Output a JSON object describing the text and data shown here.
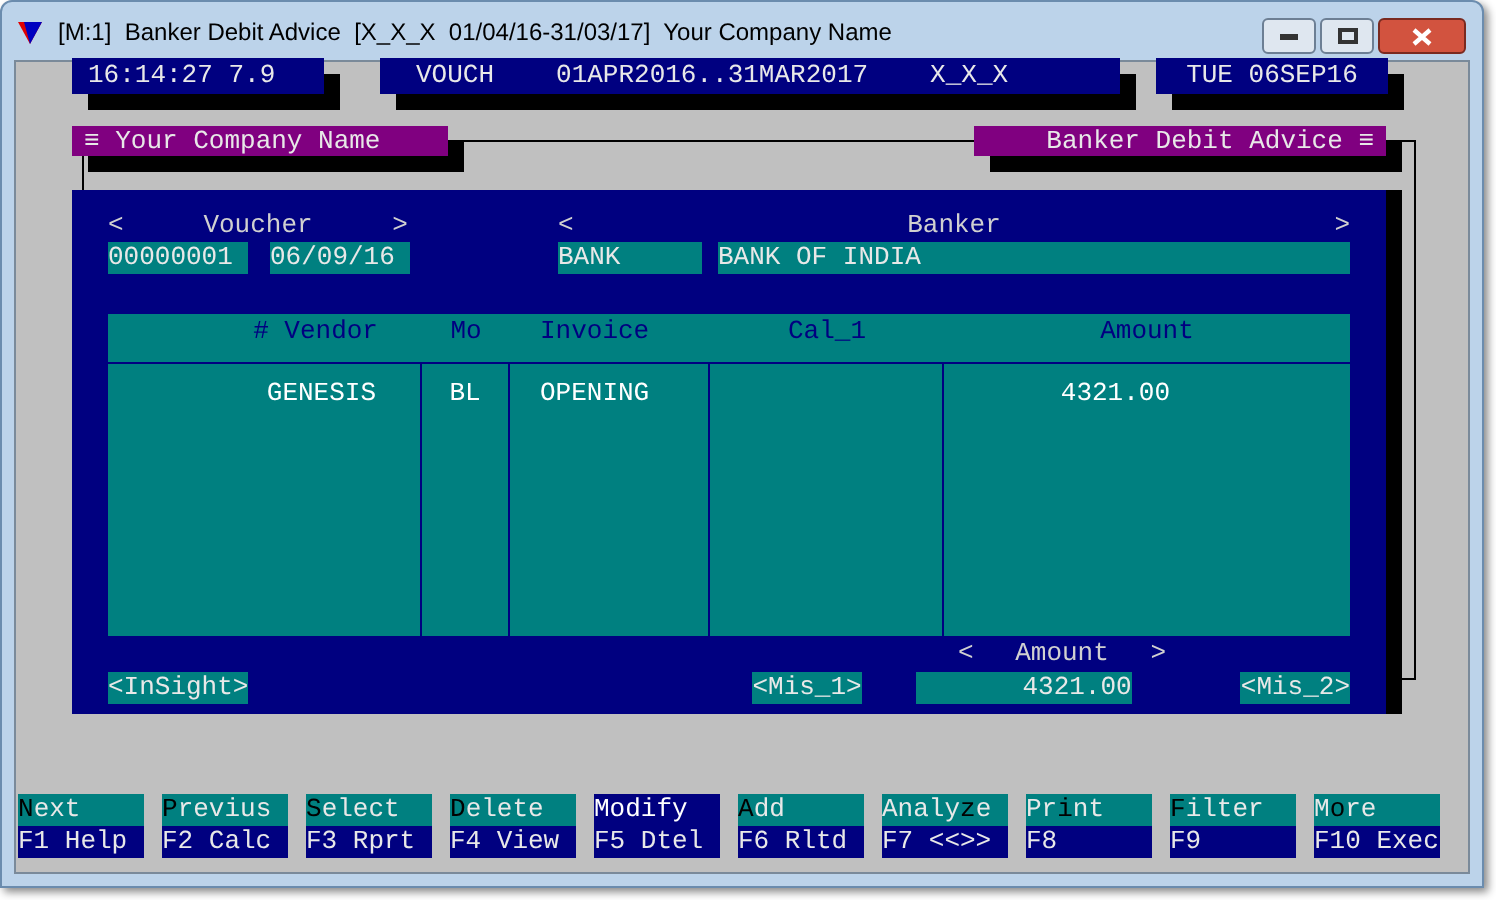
{
  "window": {
    "title": "[M:1]  Banker Debit Advice  [X_X_X  01/04/16-31/03/17]  Your Company Name"
  },
  "status_bar": {
    "clock": "16:14:27 7.9",
    "mode": "VOUCH",
    "period": "01APR2016..31MAR2017",
    "user": "X_X_X",
    "date": "TUE 06SEP16"
  },
  "panel": {
    "left_tab": "≡ Your Company Name",
    "right_tab": "Banker Debit Advice ≡"
  },
  "voucher": {
    "label_left": "<",
    "label": "Voucher",
    "label_right": ">",
    "number": "00000001",
    "date": "06/09/16"
  },
  "banker": {
    "label_left": "<",
    "label": "Banker",
    "label_right": ">",
    "code": "BANK",
    "name": "BANK OF INDIA"
  },
  "table": {
    "columns": [
      "# Vendor",
      "Mo",
      "Invoice",
      "Cal_1",
      "Amount"
    ],
    "rows": [
      [
        "GENESIS",
        "BL",
        "OPENING",
        "",
        "4321.00"
      ]
    ]
  },
  "footer": {
    "insight": "<InSight>",
    "mis_1": "<Mis_1>",
    "amount_left": "<",
    "amount_label": "Amount",
    "amount_right": ">",
    "amount": "4321.00",
    "mis_2": "<Mis_2>"
  },
  "function_keys": [
    {
      "hotkey": "N",
      "after": "ext",
      "key": "F1 Help",
      "selected": false
    },
    {
      "hotkey": "P",
      "after": "revius",
      "key": "F2 Calc",
      "selected": false
    },
    {
      "hotkey": "S",
      "after": "elect",
      "key": "F3 Rprt",
      "selected": false
    },
    {
      "hotkey": "D",
      "after": "elete",
      "key": "F4 View",
      "selected": false
    },
    {
      "before": "Modify",
      "key": "F5 Dtel",
      "selected": true
    },
    {
      "hotkey": "A",
      "after": "dd",
      "key": "F6 Rltd",
      "selected": false
    },
    {
      "before": "Analy",
      "hotkey": "z",
      "after": "e",
      "key": "F7 <<>>",
      "selected": false
    },
    {
      "before": "Pr",
      "hotkey": "i",
      "after": "nt",
      "key": "F8",
      "selected": false
    },
    {
      "hotkey": "F",
      "after": "ilter",
      "key": "F9",
      "selected": false
    },
    {
      "before": "M",
      "hotkey": "o",
      "after": "re",
      "key": "F10 Exec",
      "selected": false
    }
  ]
}
